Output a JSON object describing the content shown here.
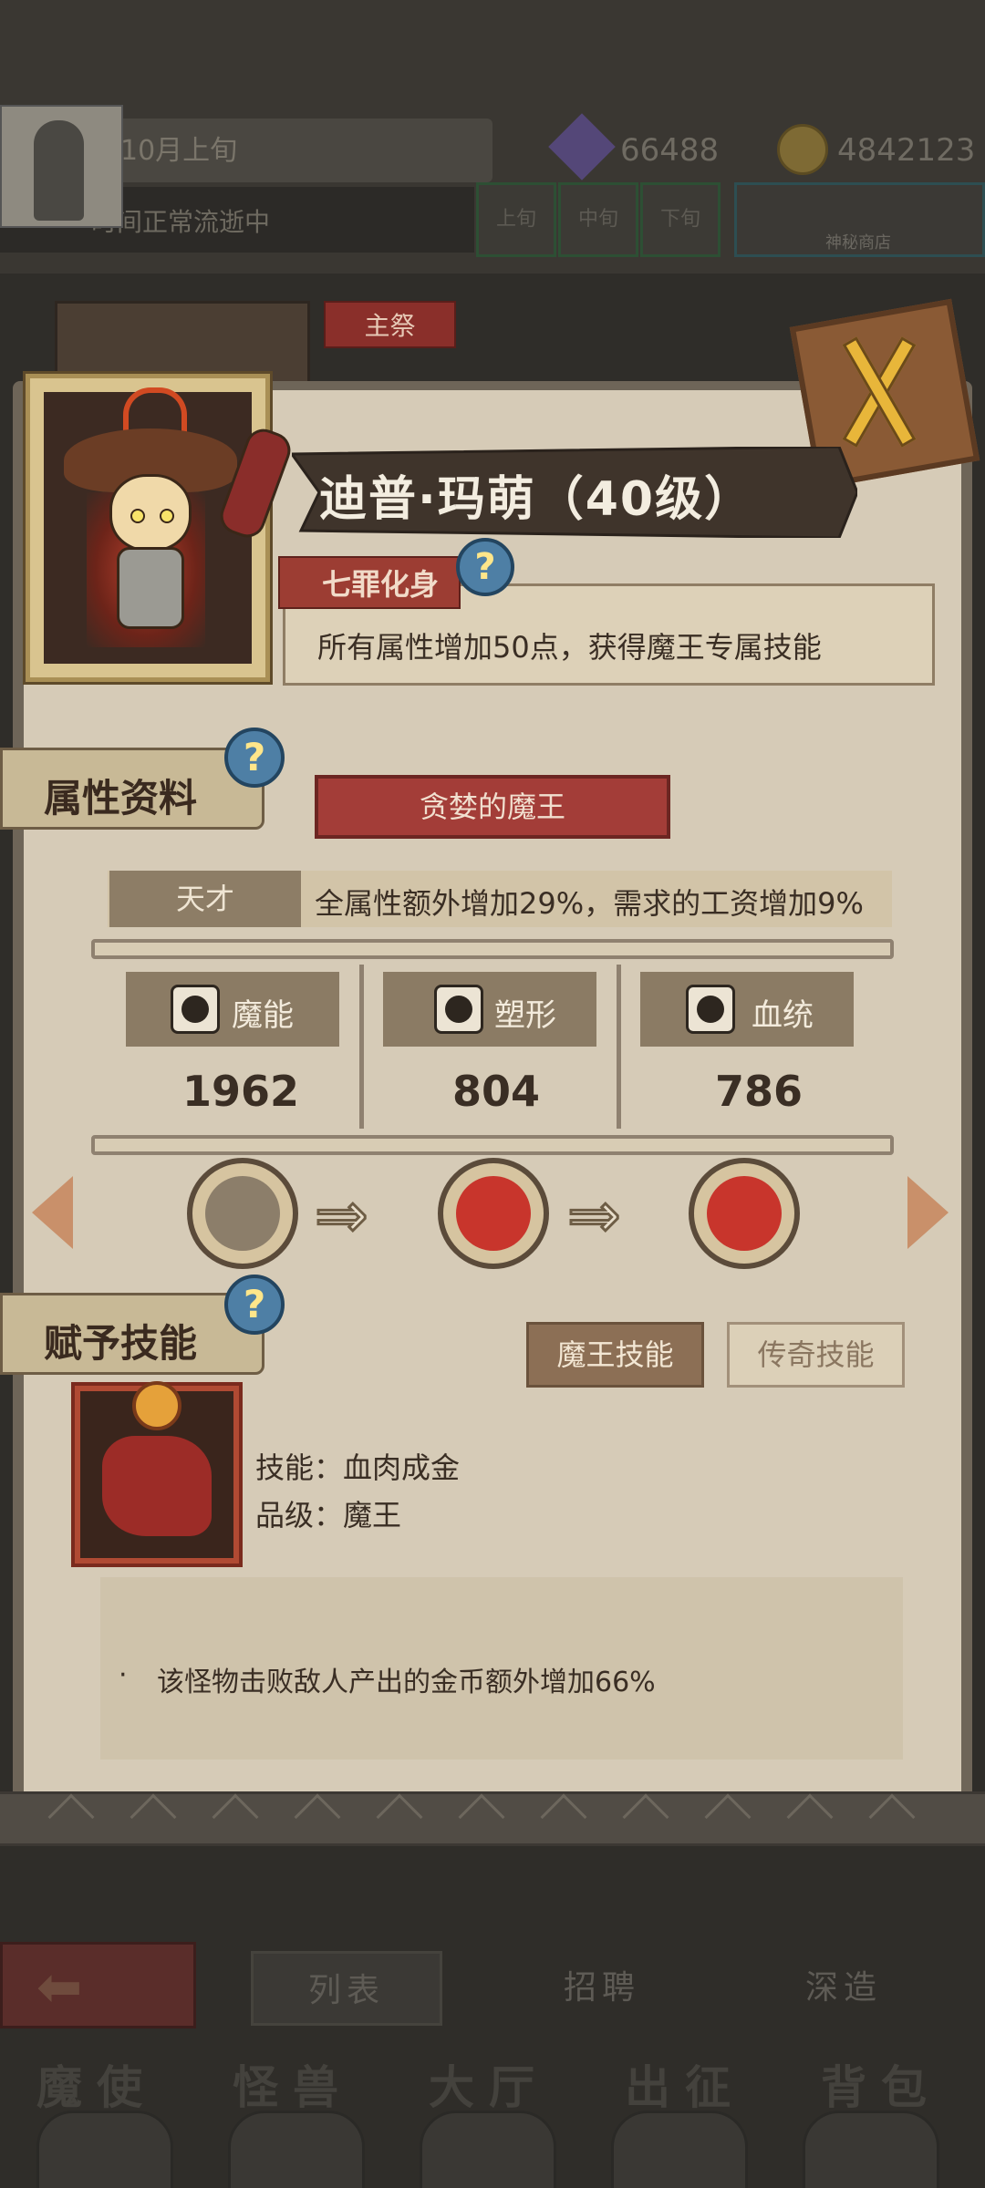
{
  "hud": {
    "date": "10月上旬",
    "time_status": "时间正常流逝中",
    "segments": [
      "上旬",
      "中旬",
      "下旬"
    ],
    "shop_label": "神秘商店",
    "crystals": "66488",
    "gold": "4842123"
  },
  "tabs": {
    "main": "主祭"
  },
  "character": {
    "name": "迪普·玛萌（40级）",
    "trait_tag": "七罪化身",
    "trait_desc": "所有属性增加50点，获得魔王专属技能"
  },
  "attributes": {
    "section_title": "属性资料",
    "subtitle": "贪婪的魔王",
    "talent_tag": "天才",
    "talent_desc": "全属性额外增加29%，需求的工资增加9%",
    "stats": [
      {
        "name": "魔能",
        "value": "1962",
        "icon": "magic-claw-icon"
      },
      {
        "name": "塑形",
        "value": "804",
        "icon": "armor-icon"
      },
      {
        "name": "血统",
        "value": "786",
        "icon": "blood-gear-icon"
      }
    ]
  },
  "evolution": {
    "stages": [
      "hooded-silhouette-icon",
      "red-demon-face-icon",
      "red-demon-face-icon"
    ]
  },
  "skills": {
    "section_title": "赋予技能",
    "btn_demon": "魔王技能",
    "btn_legend": "传奇技能",
    "skill_line": "技能：血肉成金",
    "grade_line": "品级：魔王",
    "bullet": "·",
    "desc": "该怪物击败敌人产出的金币额外增加66%"
  },
  "bottom": {
    "back_icon": "back-arrow-icon",
    "tab_list": "列表",
    "tab_recruit": "招聘",
    "tab_forge": "深造",
    "nav": [
      "魔使",
      "怪兽",
      "大厅",
      "出征",
      "背包"
    ]
  },
  "colors": {
    "panel": "#d6cbb7",
    "accent_red": "#a33d38",
    "help_blue": "#4e7fa5"
  }
}
